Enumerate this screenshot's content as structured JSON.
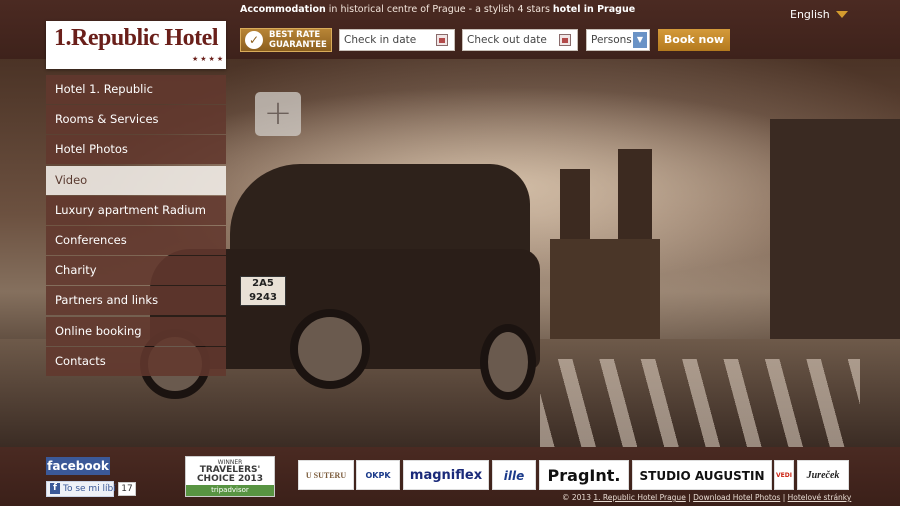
{
  "header": {
    "tagline_parts": [
      "Accommodation",
      " in historical centre of Prague - a stylish 4 stars ",
      "hotel in Prague"
    ],
    "language": "English",
    "logo_text": "1.Republic Hotel",
    "logo_stars": "★★★★"
  },
  "booking": {
    "best_rate_line1": "BEST RATE",
    "best_rate_line2": "GUARANTEE",
    "check_in": "Check in date",
    "check_out": "Check out date",
    "persons": "Persons",
    "book_now": "Book now"
  },
  "nav": {
    "items": [
      "Hotel 1. Republic",
      "Rooms & Services",
      "Hotel Photos",
      "Video",
      "Luxury apartment Radium",
      "Conferences",
      "Charity",
      "Partners and links",
      "Online booking",
      "Contacts"
    ],
    "active_index": 3
  },
  "hero": {
    "plus_label": "+",
    "plate_line1": "2A5",
    "plate_line2": "9243"
  },
  "footer": {
    "facebook": "facebook",
    "fb_like": "To se mi líbí",
    "fb_count": "17",
    "ta_winner": "WINNER",
    "ta_title1": "TRAVELERS'",
    "ta_title2": "CHOICE 2013",
    "ta_brand": "tripadvisor",
    "partners": [
      "U SUTERU",
      "OKPK",
      "magniflex",
      "ille",
      "PragInt.",
      "STUDIO AUGUSTIN",
      "VEDI",
      "Jureček"
    ],
    "copyright": "© 2013",
    "links": [
      "1. Republic Hotel Prague",
      "Download Hotel Photos",
      "Hotelové stránky"
    ]
  },
  "colors": {
    "brand_dark": "#4a2c24",
    "accent_gold": "#d49a3a",
    "nav_bg": "#62382e"
  }
}
